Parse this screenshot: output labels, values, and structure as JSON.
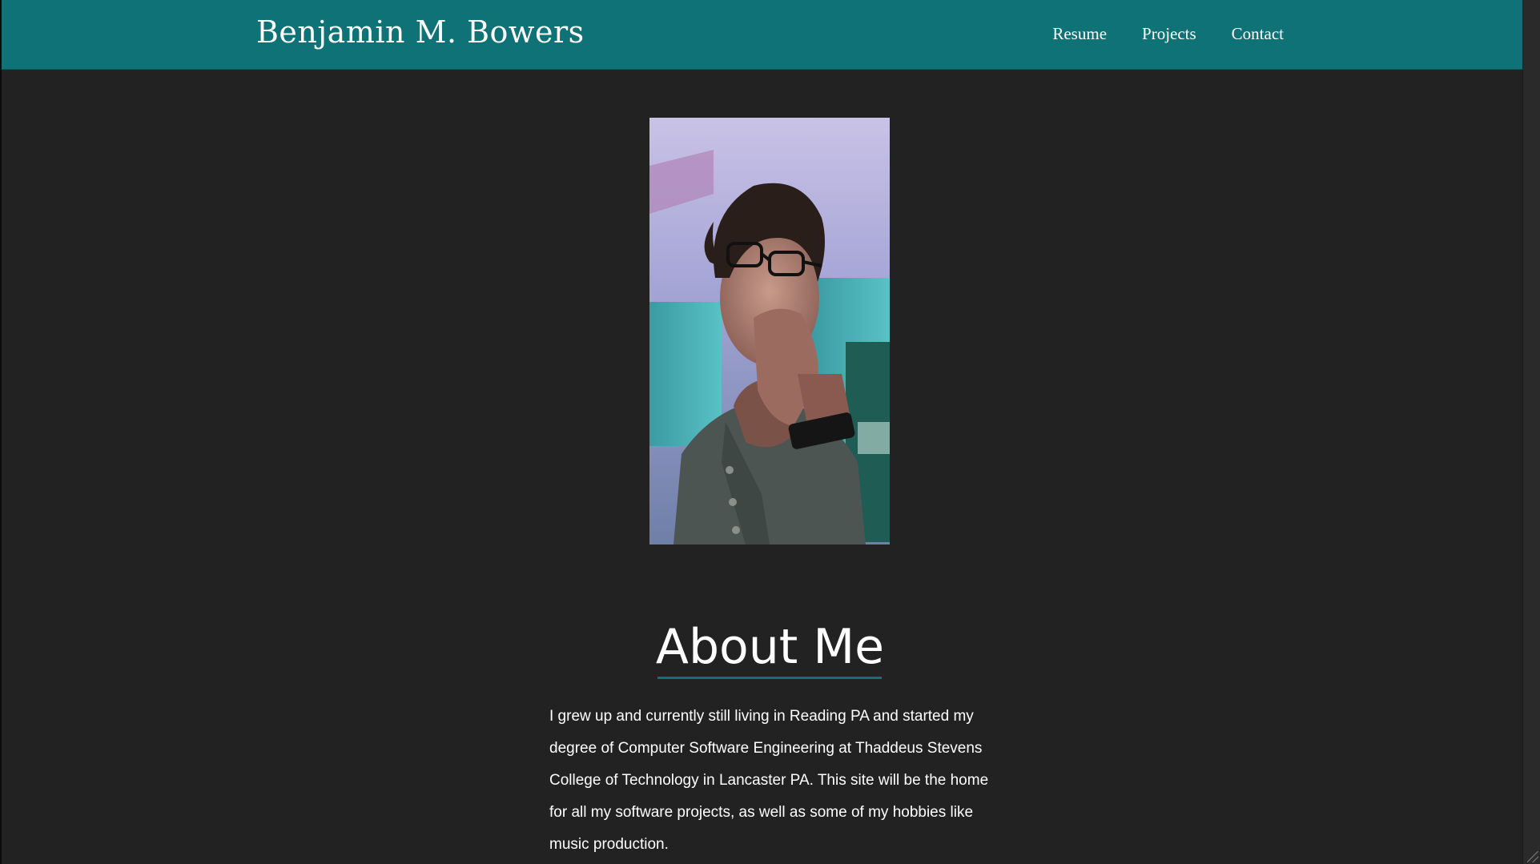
{
  "header": {
    "site_title": "Benjamin M. Bowers",
    "nav": [
      {
        "label": "Resume"
      },
      {
        "label": "Projects"
      },
      {
        "label": "Contact"
      }
    ]
  },
  "main": {
    "portrait_icon": "portrait-photo",
    "about_heading": "About Me",
    "about_text": "I grew up and currently still living in Reading PA and started my degree of Computer Software Engineering at Thaddeus Stevens College of Technology in Lancaster PA. This site will be the home for all my software projects, as well as some of my hobbies like music production."
  },
  "colors": {
    "accent": "#0e7277",
    "background": "#222222",
    "text": "#ffffff"
  }
}
